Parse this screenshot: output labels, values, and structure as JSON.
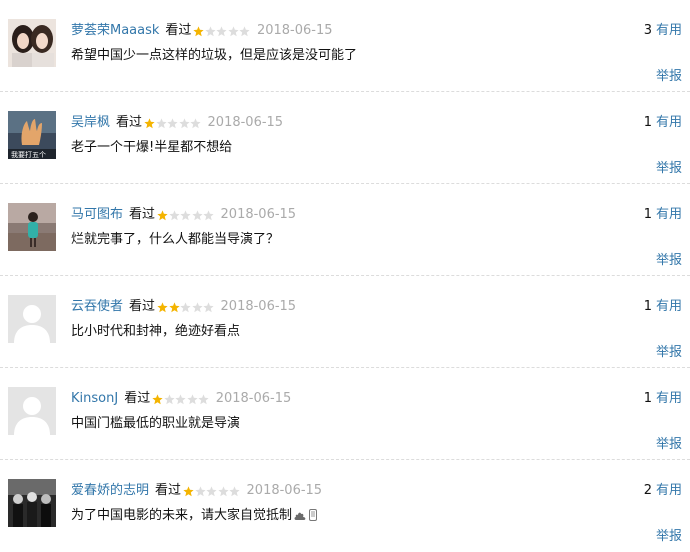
{
  "watched_label": "看过",
  "useful_label": "有用",
  "report_label": "举报",
  "colors": {
    "link": "#3377aa",
    "star_on": "#f4b400",
    "star_off": "#dddddd",
    "date": "#aaaaaa"
  },
  "reviews": [
    {
      "user": "萝荟荣Maaask",
      "rating": 1,
      "date": "2018-06-15",
      "content": "希望中国少一点这样的垃圾，但是应该是没可能了",
      "useful_count": "3",
      "avatar_icon": "avatar-two-girls-photo"
    },
    {
      "user": "吴岸枫",
      "rating": 1,
      "date": "2018-06-15",
      "content": "老子一个干爆!半星都不想给",
      "useful_count": "1",
      "avatar_icon": "avatar-hand-photo"
    },
    {
      "user": "马可图布",
      "rating": 1,
      "date": "2018-06-15",
      "content": "烂就完事了，什么人都能当导演了？",
      "useful_count": "1",
      "avatar_icon": "avatar-person-scenery-photo"
    },
    {
      "user": "云吞使者",
      "rating": 2,
      "date": "2018-06-15",
      "content": "比小时代和封神，绝迹好看点",
      "useful_count": "1",
      "avatar_icon": "avatar-default-placeholder"
    },
    {
      "user": "KinsonJ",
      "rating": 1,
      "date": "2018-06-15",
      "content": "中国门槛最低的职业就是导演",
      "useful_count": "1",
      "avatar_icon": "avatar-default-placeholder"
    },
    {
      "user": "爱春娇的志明",
      "rating": 1,
      "date": "2018-06-15",
      "content": "为了中国电影的未来，请大家自觉抵制",
      "useful_count": "2",
      "avatar_icon": "avatar-group-bw-photo"
    }
  ],
  "avatar_overlay_text": "我要打五个"
}
